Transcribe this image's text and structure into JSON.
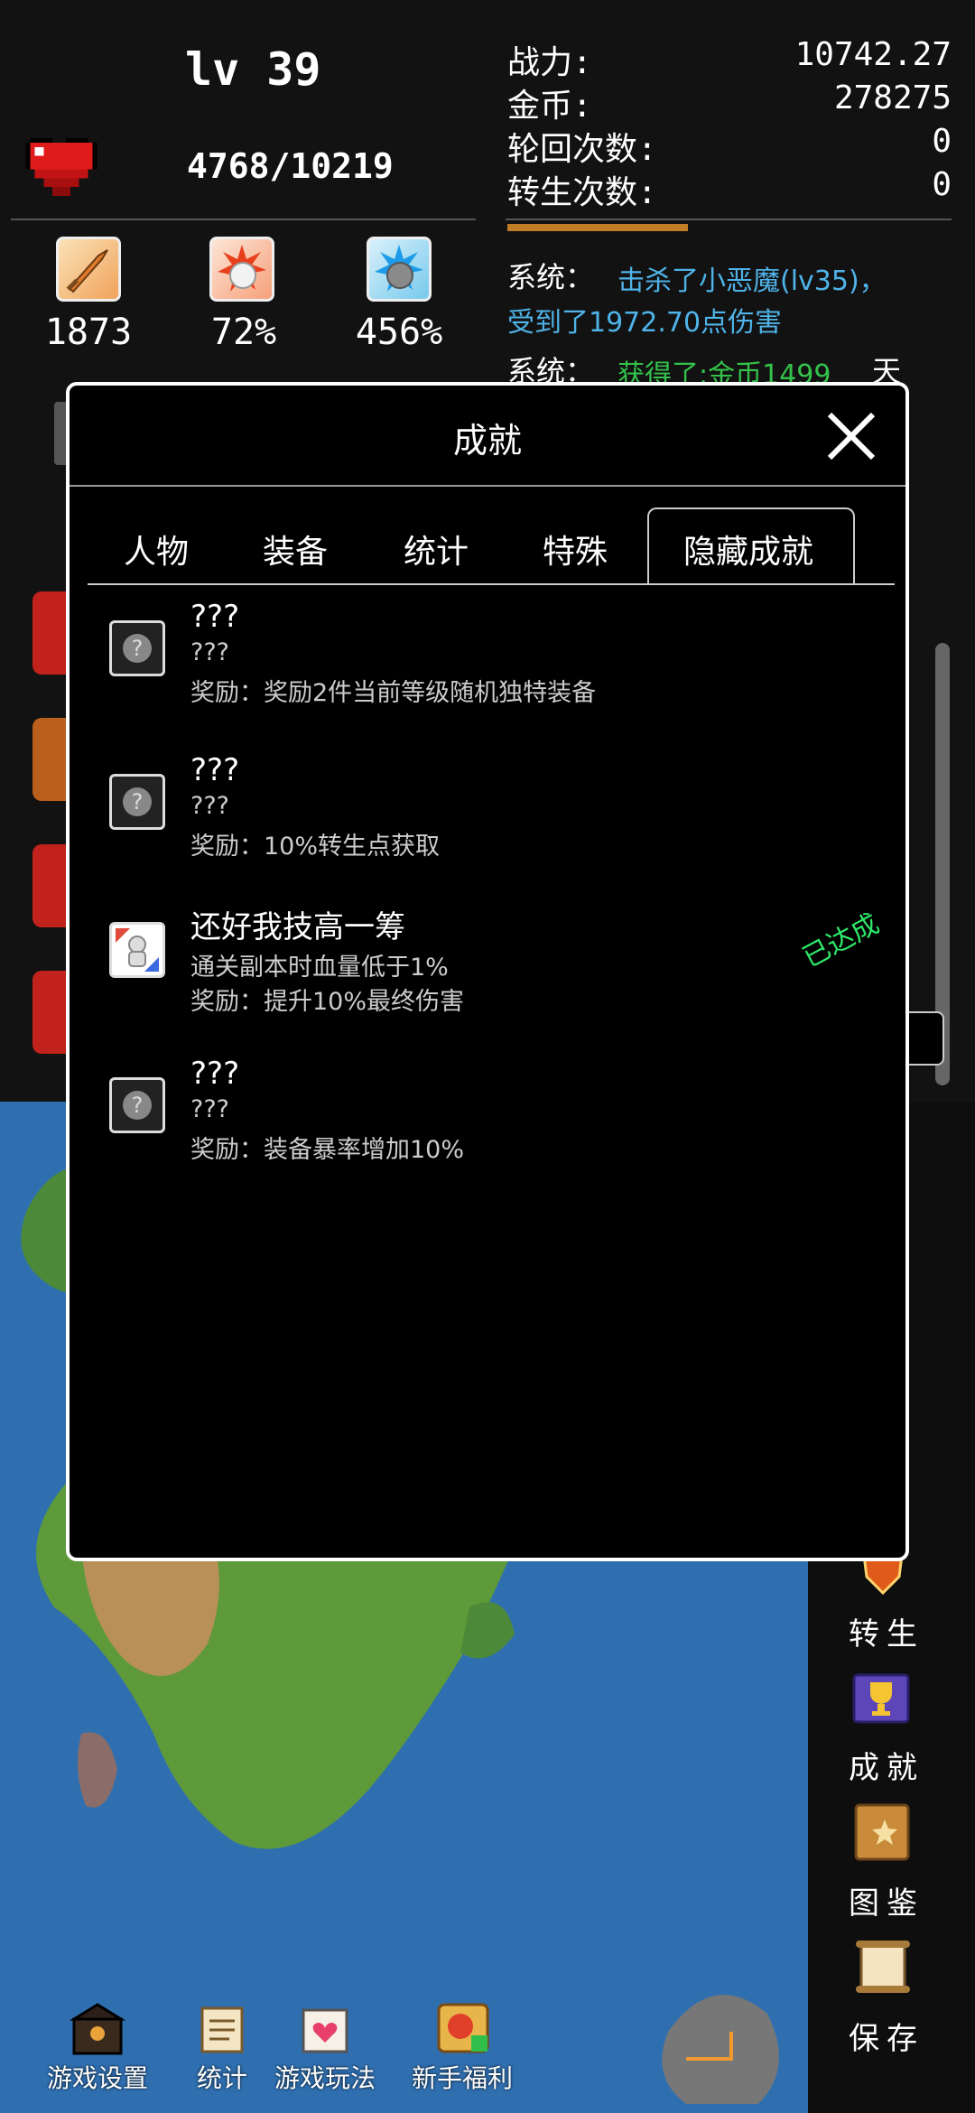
{
  "hud": {
    "level": "lv 39",
    "hp": "4768/10219",
    "stats": [
      {
        "icon": "sword-icon",
        "value": "1873"
      },
      {
        "icon": "crit-fist-icon",
        "value": "72%"
      },
      {
        "icon": "crit-damage-fist-icon",
        "value": "456%"
      }
    ],
    "right": [
      {
        "label": "战力:",
        "value": "10742.27"
      },
      {
        "label": "金币:",
        "value": "278275"
      },
      {
        "label": "轮回次数:",
        "value": "0"
      },
      {
        "label": "转生次数:",
        "value": "0"
      }
    ]
  },
  "log": {
    "line1_prefix": "系统：",
    "line1_text": "击杀了小恶魔(lv35)，",
    "line1_cont": "受到了1972.70点伤害",
    "line2_prefix": "系统：",
    "line2_text": "获得了:金币1499",
    "line2_extra": "天"
  },
  "dialog": {
    "title": "成就",
    "tabs": [
      "人物",
      "装备",
      "统计",
      "特殊",
      "隐藏成就"
    ],
    "active_tab": "隐藏成就",
    "achievements": [
      {
        "title": "???",
        "desc": "???",
        "reward": "奖励：奖励2件当前等级随机独特装备",
        "icon": "locked-question-icon",
        "done": false
      },
      {
        "title": "???",
        "desc": "???",
        "reward": "奖励：10%转生点获取",
        "icon": "locked-question-icon",
        "done": false
      },
      {
        "title": "还好我技高一筹",
        "desc": "通关副本时血量低于1%",
        "reward": "奖励：提升10%最终伤害",
        "icon": "hero-skill-icon",
        "done": true
      },
      {
        "title": "???",
        "desc": "???",
        "reward": "奖励：装备暴率增加10%",
        "icon": "locked-question-icon",
        "done": false
      }
    ],
    "done_label": "已达成"
  },
  "side_menu": [
    {
      "label": "转生",
      "icon": "rebirth-shield-icon"
    },
    {
      "label": "成就",
      "icon": "trophy-book-icon"
    },
    {
      "label": "图鉴",
      "icon": "codex-book-icon"
    },
    {
      "label": "保存",
      "icon": "save-scroll-icon"
    }
  ],
  "bottom_bar": [
    {
      "label": "游戏设置",
      "icon": "settings-chest-icon"
    },
    {
      "label": "统计",
      "icon": "stats-scroll-icon"
    },
    {
      "label": "游戏玩法",
      "icon": "gameplay-calendar-icon"
    },
    {
      "label": "新手福利",
      "icon": "newbie-gift-icon"
    }
  ],
  "colors": {
    "accent_cyan": "#4fb3e8",
    "accent_green": "#34c24a",
    "done_green": "#2ee86a",
    "log_orange": "#e0922a"
  }
}
